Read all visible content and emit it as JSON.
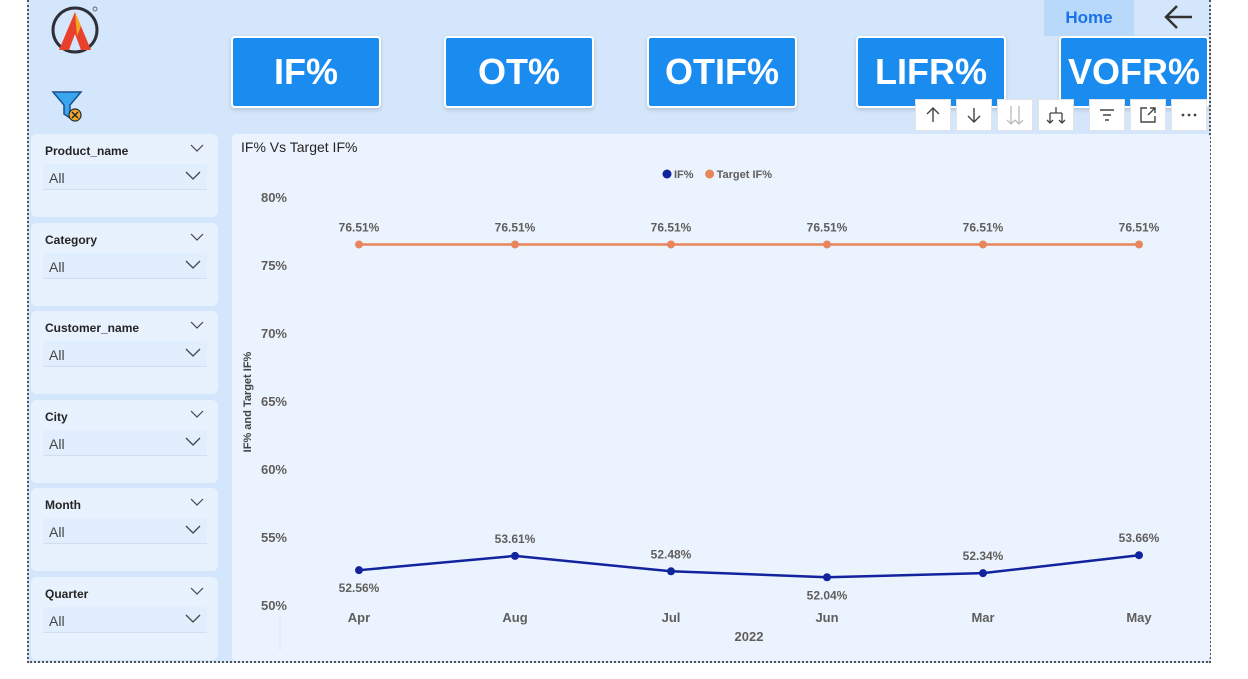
{
  "header": {
    "home_label": "Home",
    "kpi_buttons": [
      "IF%",
      "OT%",
      "OTIF%",
      "LIFR%",
      "VOFR%"
    ]
  },
  "slicers": [
    {
      "title": "Product_name",
      "value": "All"
    },
    {
      "title": "Category",
      "value": "All"
    },
    {
      "title": "Customer_name",
      "value": "All"
    },
    {
      "title": "City",
      "value": "All"
    },
    {
      "title": "Month",
      "value": "All"
    },
    {
      "title": "Quarter",
      "value": "All"
    }
  ],
  "colors": {
    "background": "#d4e6fb",
    "kpi_button": "#1a8cf0",
    "series_if": "#12239e",
    "series_target": "#e8855c"
  },
  "chart_data": {
    "type": "line",
    "title": "IF% Vs Target IF%",
    "xlabel": "2022",
    "ylabel": "IF% and Target IF%",
    "categories": [
      "Apr",
      "Aug",
      "Jul",
      "Jun",
      "Mar",
      "May"
    ],
    "y_ticks": [
      "80%",
      "75%",
      "70%",
      "65%",
      "60%",
      "55%",
      "50%"
    ],
    "ylim": [
      50,
      80
    ],
    "legend": "top-center",
    "series": [
      {
        "name": "IF%",
        "values": [
          52.56,
          53.61,
          52.48,
          52.04,
          52.34,
          53.66
        ],
        "labels": [
          "52.56%",
          "53.61%",
          "52.48%",
          "52.04%",
          "52.34%",
          "53.66%"
        ],
        "color": "#12239e"
      },
      {
        "name": "Target IF%",
        "values": [
          76.51,
          76.51,
          76.51,
          76.51,
          76.51,
          76.51
        ],
        "labels": [
          "76.51%",
          "76.51%",
          "76.51%",
          "76.51%",
          "76.51%",
          "76.51%"
        ],
        "color": "#e8855c"
      }
    ]
  }
}
